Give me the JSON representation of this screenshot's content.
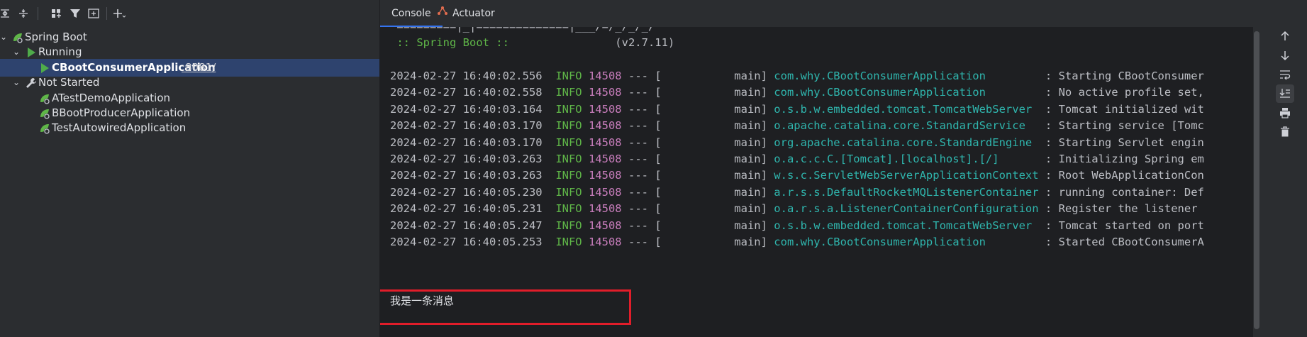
{
  "toolbar": {
    "buttons": [
      "expand-all",
      "collapse-all",
      "group-by",
      "filter",
      "new-service",
      "add"
    ]
  },
  "tree": {
    "root": {
      "label": "Spring Boot"
    },
    "running_group": {
      "label": "Running"
    },
    "running_items": [
      {
        "label": "CBootConsumerApplication",
        "port": ":8081/"
      }
    ],
    "not_started_group": {
      "label": "Not Started"
    },
    "not_started_items": [
      {
        "label": "ATestDemoApplication"
      },
      {
        "label": "BBootProducerApplication"
      },
      {
        "label": "TestAutowiredApplication"
      }
    ]
  },
  "tabs": [
    {
      "label": "Console",
      "active": true
    },
    {
      "label": "Actuator",
      "active": false
    }
  ],
  "console": {
    "banner_line1": " =========|_|==============|___/=/_/_/_/",
    "banner_line2_prefix": " :: Spring Boot :: ",
    "banner_line2_version": "               (v2.7.11)",
    "logs": [
      {
        "ts": "2024-02-27 16:40:02.556",
        "level": "INFO",
        "pid": "14508",
        "sep": " --- [           main] ",
        "logger": "com.why.CBootConsumerApplication        ",
        "msg": " : Starting CBootConsumer"
      },
      {
        "ts": "2024-02-27 16:40:02.558",
        "level": "INFO",
        "pid": "14508",
        "sep": " --- [           main] ",
        "logger": "com.why.CBootConsumerApplication        ",
        "msg": " : No active profile set,"
      },
      {
        "ts": "2024-02-27 16:40:03.164",
        "level": "INFO",
        "pid": "14508",
        "sep": " --- [           main] ",
        "logger": "o.s.b.w.embedded.tomcat.TomcatWebServer ",
        "msg": " : Tomcat initialized wit"
      },
      {
        "ts": "2024-02-27 16:40:03.170",
        "level": "INFO",
        "pid": "14508",
        "sep": " --- [           main] ",
        "logger": "o.apache.catalina.core.StandardService  ",
        "msg": " : Starting service [Tomc"
      },
      {
        "ts": "2024-02-27 16:40:03.170",
        "level": "INFO",
        "pid": "14508",
        "sep": " --- [           main] ",
        "logger": "org.apache.catalina.core.StandardEngine ",
        "msg": " : Starting Servlet engin"
      },
      {
        "ts": "2024-02-27 16:40:03.263",
        "level": "INFO",
        "pid": "14508",
        "sep": " --- [           main] ",
        "logger": "o.a.c.c.C.[Tomcat].[localhost].[/]      ",
        "msg": " : Initializing Spring em"
      },
      {
        "ts": "2024-02-27 16:40:03.263",
        "level": "INFO",
        "pid": "14508",
        "sep": " --- [           main] ",
        "logger": "w.s.c.ServletWebServerApplicationContext",
        "msg": " : Root WebApplicationCon"
      },
      {
        "ts": "2024-02-27 16:40:05.230",
        "level": "INFO",
        "pid": "14508",
        "sep": " --- [           main] ",
        "logger": "a.r.s.s.DefaultRocketMQListenerContainer",
        "msg": " : running container: Def"
      },
      {
        "ts": "2024-02-27 16:40:05.231",
        "level": "INFO",
        "pid": "14508",
        "sep": " --- [           main] ",
        "logger": "o.a.r.s.a.ListenerContainerConfiguration",
        "msg": " : Register the listener "
      },
      {
        "ts": "2024-02-27 16:40:05.247",
        "level": "INFO",
        "pid": "14508",
        "sep": " --- [           main] ",
        "logger": "o.s.b.w.embedded.tomcat.TomcatWebServer ",
        "msg": " : Tomcat started on port"
      },
      {
        "ts": "2024-02-27 16:40:05.253",
        "level": "INFO",
        "pid": "14508",
        "sep": " --- [           main] ",
        "logger": "com.why.CBootConsumerApplication        ",
        "msg": " : Started CBootConsumerA"
      }
    ],
    "message": "我是一条消息"
  },
  "sidebar_buttons": [
    "arrow-up",
    "arrow-down",
    "soft-wrap",
    "scroll-to-end",
    "print",
    "clear-all"
  ],
  "colors": {
    "info_level": "#5fb648",
    "pid": "#c77dbb",
    "logger": "#2fb5ad",
    "highlight_box": "#e11d2a",
    "selection": "#2e436e",
    "run_green": "#4fab4a"
  }
}
